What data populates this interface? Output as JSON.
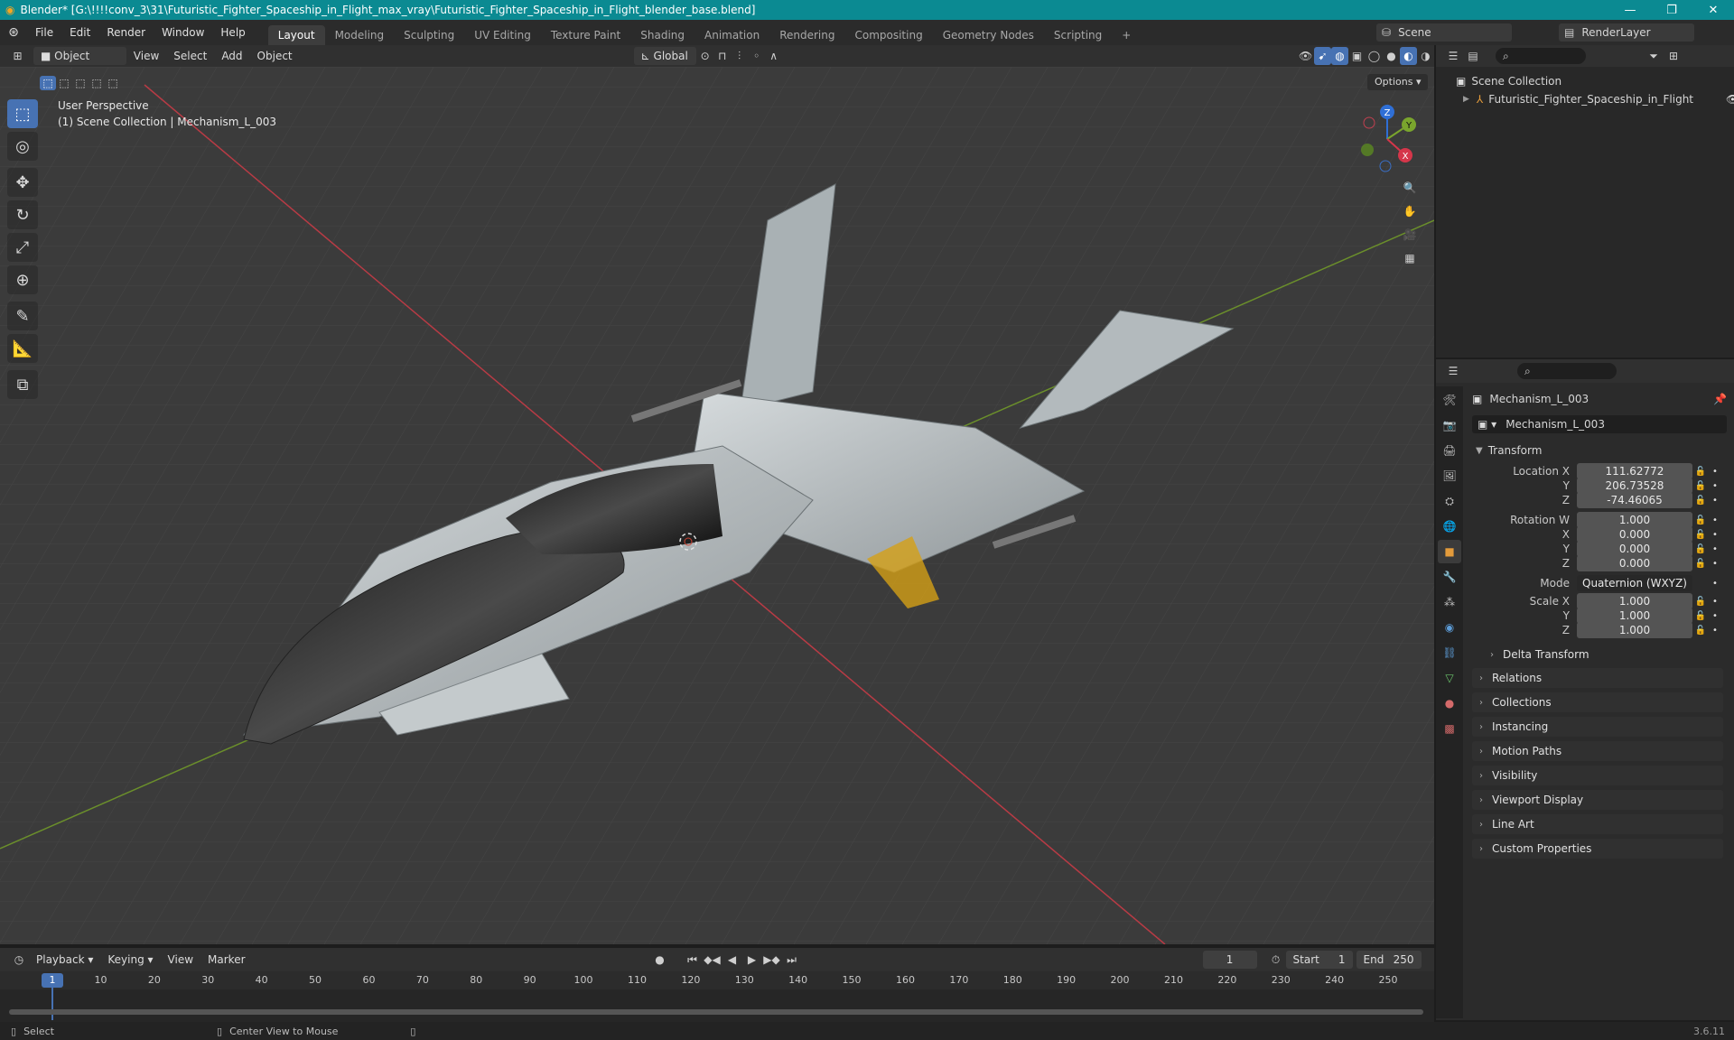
{
  "titlebar": {
    "title": "Blender* [G:\\!!!!conv_3\\31\\Futuristic_Fighter_Spaceship_in_Flight_max_vray\\Futuristic_Fighter_Spaceship_in_Flight_blender_base.blend]",
    "minimize": "—",
    "maximize": "❐",
    "close": "✕"
  },
  "menubar": {
    "menus": [
      "File",
      "Edit",
      "Render",
      "Window",
      "Help"
    ],
    "workspaces": [
      "Layout",
      "Modeling",
      "Sculpting",
      "UV Editing",
      "Texture Paint",
      "Shading",
      "Animation",
      "Rendering",
      "Compositing",
      "Geometry Nodes",
      "Scripting"
    ],
    "active_workspace": "Layout",
    "add_workspace": "+",
    "scene_label": "Scene",
    "renderlayer_label": "RenderLayer"
  },
  "viewport_header": {
    "mode": "Object Mode",
    "menus": [
      "View",
      "Select",
      "Add",
      "Object"
    ],
    "transform_orientation": "Global",
    "options": "Options"
  },
  "viewport": {
    "perspective_label": "User Perspective",
    "collection_label": "(1) Scene Collection | Mechanism_L_003",
    "gizmo_axes": [
      "Z",
      "Y",
      "X"
    ]
  },
  "outliner": {
    "scene_collection": "Scene Collection",
    "object_name": "Futuristic_Fighter_Spaceship_in_Flight"
  },
  "properties": {
    "object_name": "Mechanism_L_003",
    "data_name": "Mechanism_L_003",
    "transform_label": "Transform",
    "location_label": "Location X",
    "location": {
      "x": "111.62772",
      "y": "206.73528",
      "z": "-74.46065"
    },
    "rotation_label": "Rotation W",
    "rotation": {
      "w": "1.000",
      "x": "0.000",
      "y": "0.000",
      "z": "0.000"
    },
    "mode_label": "Mode",
    "mode_value": "Quaternion (WXYZ)",
    "scale_label": "Scale X",
    "scale": {
      "x": "1.000",
      "y": "1.000",
      "z": "1.000"
    },
    "axis_labels": {
      "x": "X",
      "y": "Y",
      "z": "Z"
    },
    "delta_transform": "Delta Transform",
    "panels": [
      "Relations",
      "Collections",
      "Instancing",
      "Motion Paths",
      "Visibility",
      "Viewport Display",
      "Line Art",
      "Custom Properties"
    ]
  },
  "timeline": {
    "menus": [
      "Playback",
      "Keying",
      "View",
      "Marker"
    ],
    "current_frame": "1",
    "start_label": "Start",
    "start": "1",
    "end_label": "End",
    "end": "250",
    "ticks": [
      "1",
      "10",
      "20",
      "30",
      "40",
      "50",
      "60",
      "70",
      "80",
      "90",
      "100",
      "110",
      "120",
      "130",
      "140",
      "150",
      "160",
      "170",
      "180",
      "190",
      "200",
      "210",
      "220",
      "230",
      "240",
      "250"
    ]
  },
  "statusbar": {
    "select": "Select",
    "center_view": "Center View to Mouse",
    "version": "3.6.11"
  }
}
